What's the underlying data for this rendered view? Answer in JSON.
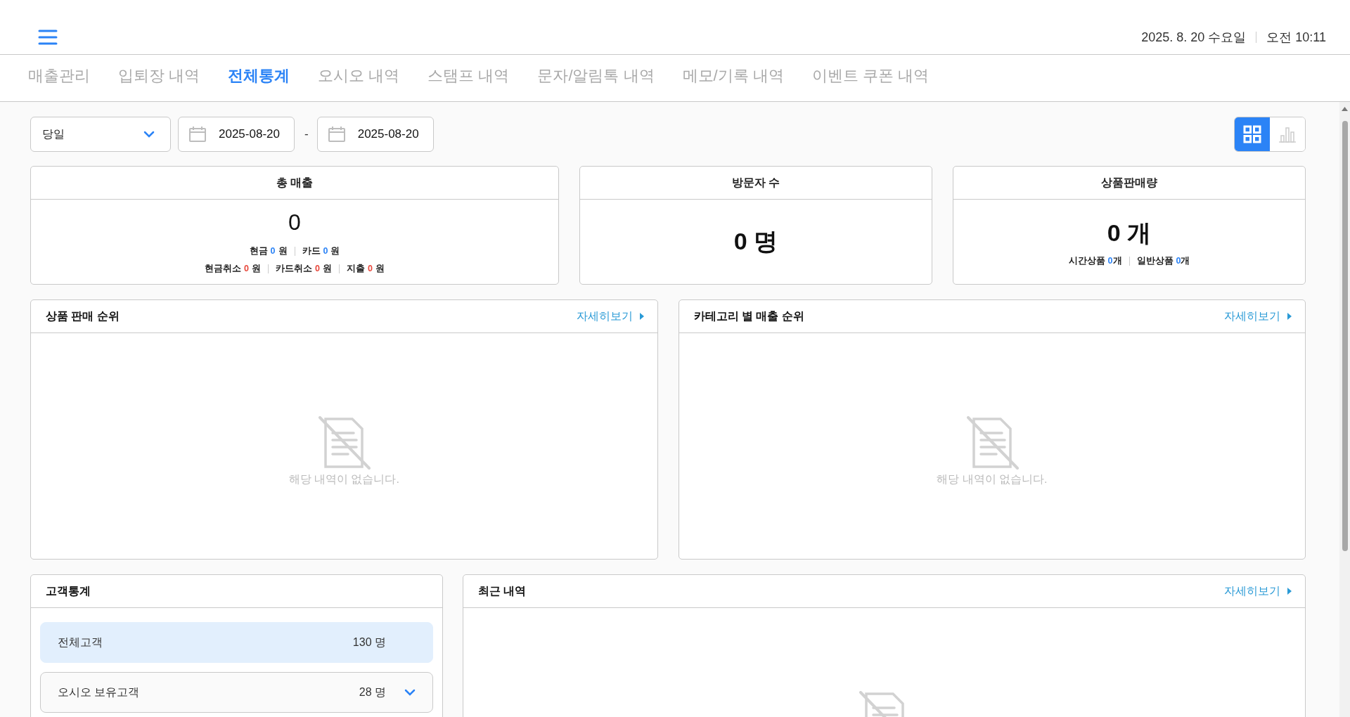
{
  "header": {
    "date": "2025. 8. 20 수요일",
    "time": "오전 10:11"
  },
  "tabs": [
    {
      "label": "매출관리",
      "selected": false
    },
    {
      "label": "입퇴장 내역",
      "selected": false
    },
    {
      "label": "전체통계",
      "selected": true
    },
    {
      "label": "오시오 내역",
      "selected": false
    },
    {
      "label": "스탬프 내역",
      "selected": false
    },
    {
      "label": "문자/알림톡 내역",
      "selected": false
    },
    {
      "label": "메모/기록 내역",
      "selected": false
    },
    {
      "label": "이벤트 쿠폰 내역",
      "selected": false
    }
  ],
  "filters": {
    "period": "당일",
    "start_date": "2025-08-20",
    "separator": "-",
    "end_date": "2025-08-20",
    "view_toggle": [
      {
        "kind": "grid",
        "selected": true
      },
      {
        "kind": "chart",
        "selected": false
      }
    ]
  },
  "stat_cards": [
    {
      "title": "총 매출",
      "kind": "small",
      "value": "0",
      "unit_spaced": true,
      "lines": [
        [
          {
            "label": "현금",
            "amount": "0",
            "unit": "원",
            "color": "#2b83f6"
          },
          {
            "label": "카드",
            "amount": "0",
            "unit": "원",
            "color": "#2b83f6"
          }
        ],
        [
          {
            "label": "현금취소",
            "amount": "0",
            "unit": "원",
            "color": "#e8473b"
          },
          {
            "label": "카드취소",
            "amount": "0",
            "unit": "원",
            "color": "#e8473b"
          },
          {
            "label": "지출",
            "amount": "0",
            "unit": "원",
            "color": "#e8473b"
          }
        ]
      ]
    },
    {
      "title": "방문자 수",
      "kind": "large",
      "value": "0 명"
    },
    {
      "title": "상품판매량",
      "kind": "large",
      "value": "0 개",
      "lines": [
        [
          {
            "label": "시간상품",
            "amount": "0",
            "unit": "개",
            "color": "#2b83f6"
          },
          {
            "label": "일반상품",
            "amount": "0",
            "unit": "개",
            "color": "#2b83f6"
          }
        ]
      ]
    }
  ],
  "panels": [
    {
      "title": "상품 판매 순위",
      "more_link": "자세히보기",
      "empty_text": "해당 내역이 없습니다."
    },
    {
      "title": "카테고리 별 매출 순위",
      "more_link": "자세히보기",
      "empty_text": "해당 내역이 없습니다."
    }
  ],
  "customer_stats": {
    "title": "고객통계",
    "rows": [
      {
        "kind": "summary",
        "label": "전체고객",
        "count": "130 명",
        "selected": true
      },
      {
        "kind": "expandable",
        "label": "오시오 보유고객",
        "count": "28 명",
        "selected": false
      }
    ]
  },
  "recent": {
    "title": "최근 내역",
    "more_link": "자세히보기"
  }
}
